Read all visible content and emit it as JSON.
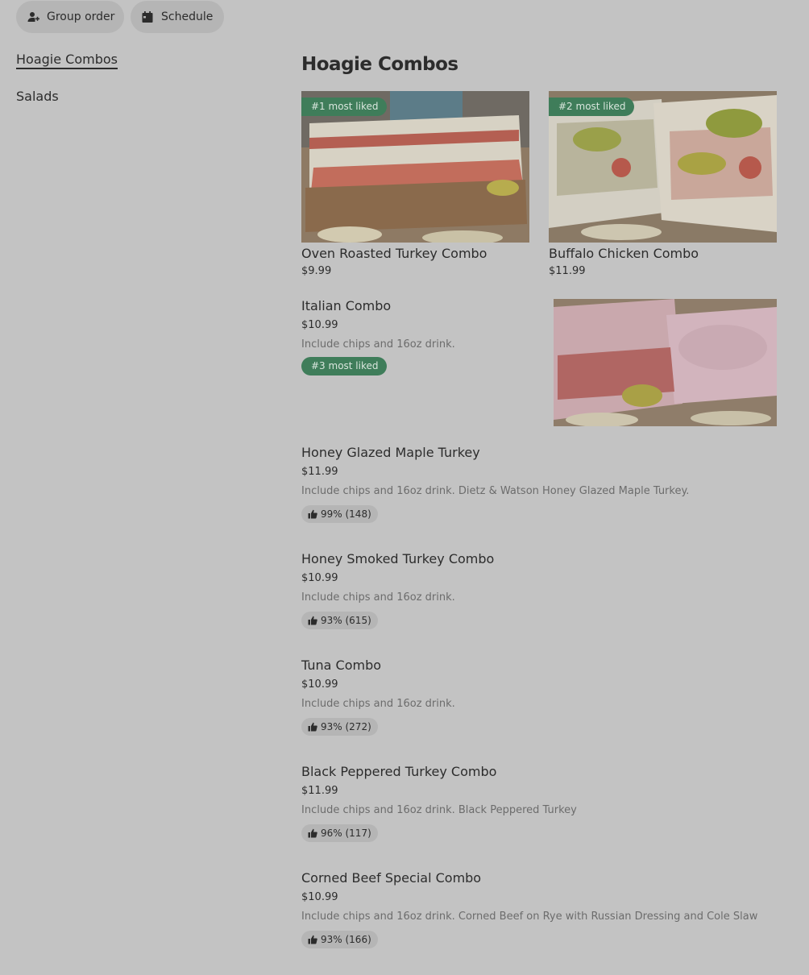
{
  "header": {
    "group_order_label": "Group order",
    "schedule_label": "Schedule"
  },
  "sidebar": {
    "items": [
      {
        "label": "Hoagie Combos",
        "active": true
      },
      {
        "label": "Salads",
        "active": false
      }
    ]
  },
  "section": {
    "title": "Hoagie Combos"
  },
  "featured": [
    {
      "badge": "#1 most liked",
      "name": "Oven Roasted Turkey Combo",
      "price": "$9.99"
    },
    {
      "badge": "#2 most liked",
      "name": "Buffalo Chicken Combo",
      "price": "$11.99"
    }
  ],
  "items": [
    {
      "name": "Italian Combo",
      "price": "$10.99",
      "description": "Include chips and 16oz drink.",
      "badge": "#3 most liked"
    },
    {
      "name": "Honey Glazed Maple Turkey",
      "price": "$11.99",
      "description": "Include chips and 16oz drink. Dietz & Watson Honey Glazed Maple Turkey.",
      "rating": "99% (148)"
    },
    {
      "name": "Honey Smoked Turkey Combo",
      "price": "$10.99",
      "description": "Include chips and 16oz drink.",
      "rating": "93% (615)"
    },
    {
      "name": "Tuna Combo",
      "price": "$10.99",
      "description": "Include chips and 16oz drink.",
      "rating": "93% (272)"
    },
    {
      "name": "Black Peppered Turkey Combo",
      "price": "$11.99",
      "description": "Include chips and 16oz drink. Black Peppered Turkey",
      "rating": "96% (117)"
    },
    {
      "name": "Corned Beef Special Combo",
      "price": "$10.99",
      "description": "Include chips and 16oz drink. Corned Beef on Rye with Russian Dressing and Cole Slaw",
      "rating": "93% (166)"
    }
  ],
  "colors": {
    "overlay_bg": "#c3c3c3",
    "pill_bg": "#b5b5b5",
    "badge_green": "#3f7d5a",
    "text": "#2c2c2c",
    "muted": "#6c6c6c"
  },
  "icons": {
    "group_order": "person-add-icon",
    "schedule": "calendar-icon",
    "rating": "thumbs-up-icon"
  }
}
